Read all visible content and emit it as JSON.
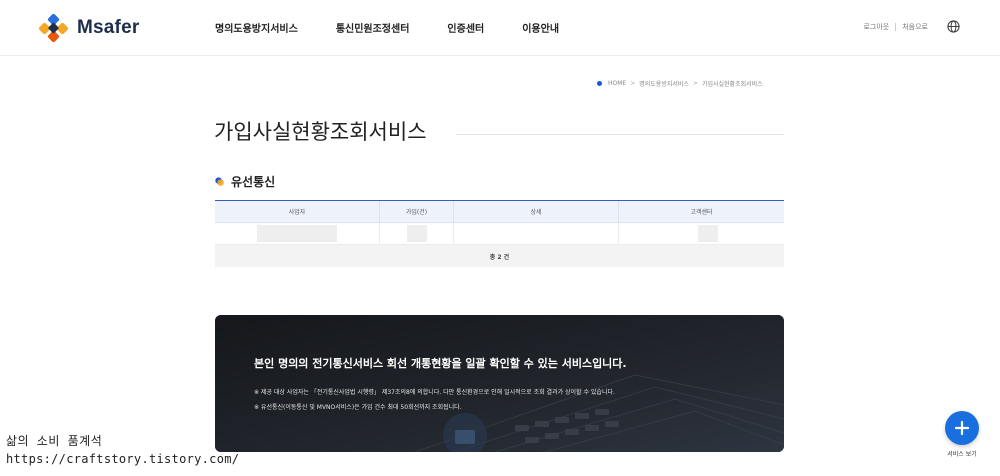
{
  "header": {
    "logo_text": "Msafer",
    "nav": [
      "명의도용방지서비스",
      "통신민원조정센터",
      "인증센터",
      "이용안내"
    ],
    "util": {
      "logout": "로그아웃",
      "home": "처음으로"
    }
  },
  "breadcrumb": [
    "HOME",
    "명의도용방지서비스",
    "가입사실현황조회서비스"
  ],
  "page_title": "가입사실현황조회서비스",
  "section_title": "유선통신",
  "table": {
    "headers": [
      "사업자",
      "가입(건)",
      "상세",
      "고객센터"
    ],
    "total": "총 2 건"
  },
  "banner": {
    "title": "본인 명의의 전기통신서비스 회선 개통현황을 일괄 확인할 수 있는 서비스입니다.",
    "note1": "※ 제공 대상 사업자는 「전기통신사업법 시행령」 제37조의8에 의합니다. 다만 통신환경으로 인해 일시적으로 조회 결과가 상이할 수 있습니다.",
    "note2": "※ 유선통신(이동통신 및 MVNO서비스)은 가입 건수 최대 50회선까지 조회됩니다."
  },
  "fab": {
    "label": "서비스 보기"
  },
  "watermark": {
    "line1": "삶의 소비 품계석",
    "line2": "https://craftstory.tistory.com/"
  },
  "colors": {
    "accent": "#1a6fe0",
    "table_top": "#2f5fc5",
    "banner_bg": "#1b1d22"
  }
}
